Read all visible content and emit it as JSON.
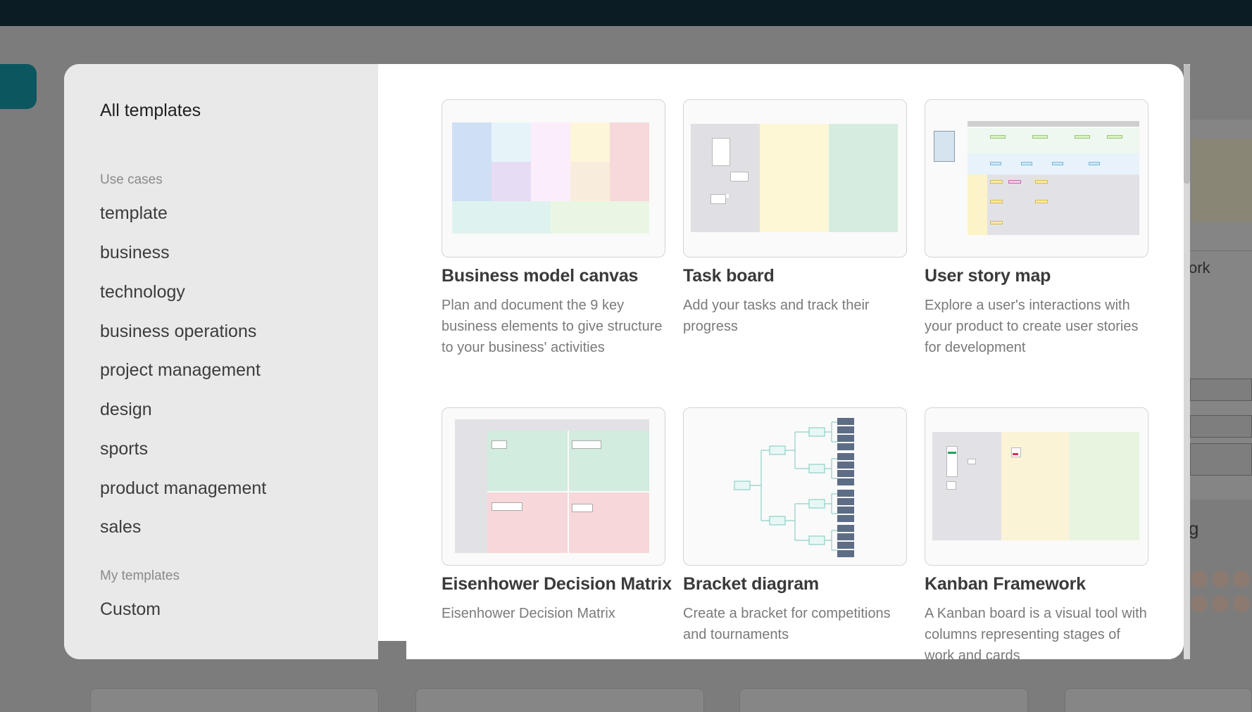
{
  "modal": {
    "title": "All templates"
  },
  "sidebar": {
    "use_cases_label": "Use cases",
    "categories": [
      "template",
      "business",
      "technology",
      "business operations",
      "project management",
      "design",
      "sports",
      "product management",
      "sales"
    ],
    "my_templates_label": "My templates",
    "custom_label": "Custom"
  },
  "templates": [
    {
      "title": "Business model canvas",
      "description": "Plan and document the 9 key business elements to give structure to your business' activities"
    },
    {
      "title": "Task board",
      "description": "Add your tasks and track their progress"
    },
    {
      "title": "User story map",
      "description": "Explore a user's interactions with your product to create user stories for development"
    },
    {
      "title": "Eisenhower Decision Matrix",
      "description": "Eisenhower Decision Matrix"
    },
    {
      "title": "Bracket diagram",
      "description": "Create a bracket for competitions and tournaments"
    },
    {
      "title": "Kanban Framework",
      "description": "A Kanban board is a visual tool with columns representing stages of work and cards"
    }
  ],
  "background": {
    "partial_word": "ork",
    "partial_g": "g"
  },
  "colors": {
    "topbar": "#0c1c24",
    "accent_teal": "#0c5660",
    "sidebar_bg": "#e9e9e9"
  }
}
